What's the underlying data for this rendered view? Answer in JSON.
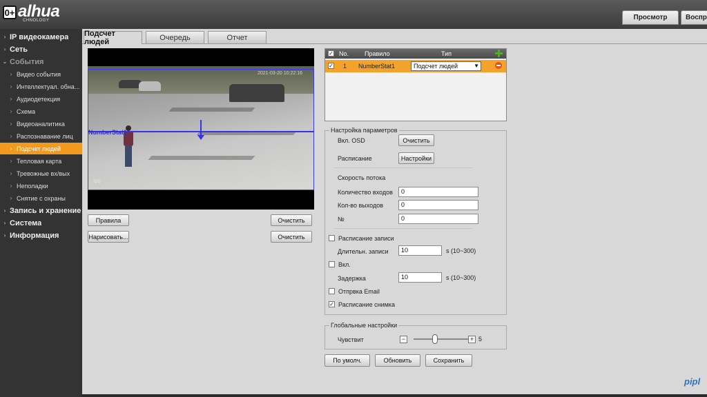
{
  "header": {
    "age_rating": "0+",
    "logo": "alhua",
    "logo_sub": "CHNOLOGY",
    "tabs": [
      "Просмотр",
      "Воспр"
    ]
  },
  "sidebar": {
    "items": [
      {
        "label": "IP видеокамера",
        "type": "group"
      },
      {
        "label": "Сеть",
        "type": "group"
      },
      {
        "label": "События",
        "type": "group-open"
      },
      {
        "label": "Видео события",
        "type": "sub"
      },
      {
        "label": "Интеллектуал. обна...",
        "type": "sub"
      },
      {
        "label": "Аудиодетекция",
        "type": "sub"
      },
      {
        "label": "Схема",
        "type": "sub"
      },
      {
        "label": "Видеоаналитика",
        "type": "sub"
      },
      {
        "label": "Распознавание лиц",
        "type": "sub"
      },
      {
        "label": "Подсчет людей",
        "type": "sub-active"
      },
      {
        "label": "Тепловая карта",
        "type": "sub"
      },
      {
        "label": "Тревожные вх/вых",
        "type": "sub"
      },
      {
        "label": "Неполадки",
        "type": "sub"
      },
      {
        "label": "Снятие с охраны",
        "type": "sub"
      },
      {
        "label": "Запись и хранение",
        "type": "group"
      },
      {
        "label": "Система",
        "type": "group"
      },
      {
        "label": "Информация",
        "type": "group"
      }
    ]
  },
  "tabs": [
    "Подсчет людей",
    "Очередь",
    "Отчет"
  ],
  "video": {
    "rule_overlay": "NumberStat1",
    "osd_time": "2021-03-20 10:22:16",
    "osd_channel": "Ipc"
  },
  "video_buttons": {
    "rules": "Правила",
    "clear1": "Очистить",
    "draw": "Нарисовать...",
    "clear2": "Очистить"
  },
  "rules_table": {
    "headers": {
      "no": "No.",
      "rule": "Правило",
      "type": "Тип"
    },
    "rows": [
      {
        "no": "1",
        "rule": "NumberStat1",
        "type": "Подсчет людей",
        "checked": true
      }
    ]
  },
  "params": {
    "legend": "Настройка параметров",
    "osd_label": "Вкл. OSD",
    "osd_button": "Очистить",
    "schedule_label": "Расписание",
    "schedule_button": "Настройки",
    "flow_label": "Скорость потока",
    "entries_label": "Количество входов",
    "entries_value": "0",
    "exits_label": "Кол-во выходов",
    "exits_value": "0",
    "no_label": "№",
    "no_value": "0",
    "record_label": "Расписание записи",
    "record_checked": false,
    "duration_label": "Длительн. записи",
    "duration_value": "10",
    "duration_range": "s (10~300)",
    "enable_label": "Вкл.",
    "enable_checked": false,
    "delay_label": "Задержка",
    "delay_value": "10",
    "delay_range": "s (10~300)",
    "email_label": "Отпрвка Email",
    "email_checked": false,
    "snapshot_label": "Расписание снимка",
    "snapshot_checked": true
  },
  "global": {
    "legend": "Глобальные настройки",
    "sensitivity_label": "Чувствит",
    "sensitivity_value": "5",
    "minus": "−",
    "plus": "+"
  },
  "actions": {
    "default": "По умолч.",
    "refresh": "Обновить",
    "save": "Сохранить"
  },
  "watermark": "pipl",
  "colors": {
    "accent": "#f39a1d",
    "row_highlight": "#f3a22b",
    "rule_line": "#3434e6"
  }
}
